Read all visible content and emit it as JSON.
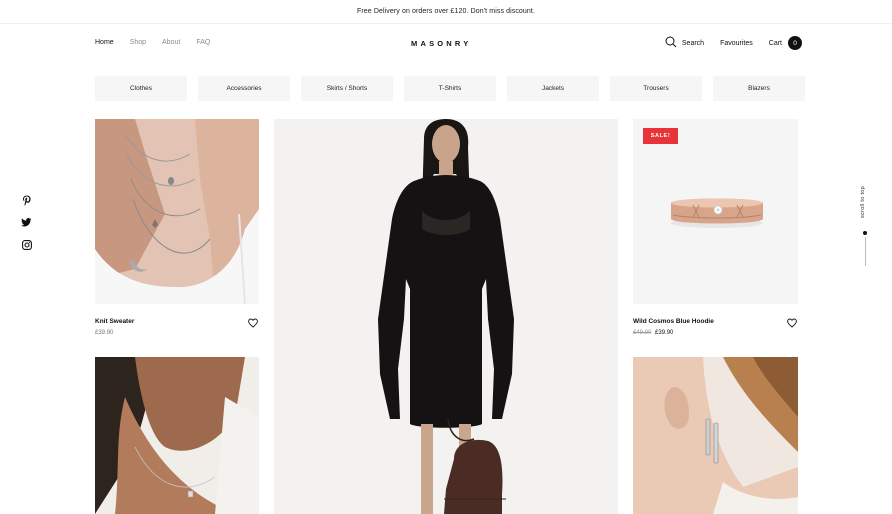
{
  "announcement": "Free Delivery on orders over £120. Don't miss discount.",
  "nav": {
    "items": [
      "Home",
      "Shop",
      "About",
      "FAQ"
    ],
    "logo": "MASONRY",
    "search_label": "Search",
    "favourites_label": "Favourites",
    "cart_label": "Cart",
    "cart_count": "0"
  },
  "categories": [
    "Clothes",
    "Accessories",
    "Skirts / Shorts",
    "T-Shirts",
    "Jackets",
    "Trousers",
    "Blazers"
  ],
  "social": {
    "icons": [
      "pinterest-icon",
      "twitter-icon",
      "instagram-icon"
    ]
  },
  "scroll_top_label": "scroll to top",
  "products": [
    {
      "title": "Knit Sweater",
      "price": "£39.90",
      "old_price": "",
      "sale": ""
    },
    {
      "title": "Wild Cosmos Blue Hoodie",
      "price": "£39.90",
      "old_price": "£49.90",
      "sale": "SALE!"
    }
  ],
  "colors": {
    "accent": "#111111",
    "sale": "#e8333a",
    "category_bg": "#f6f6f6"
  }
}
